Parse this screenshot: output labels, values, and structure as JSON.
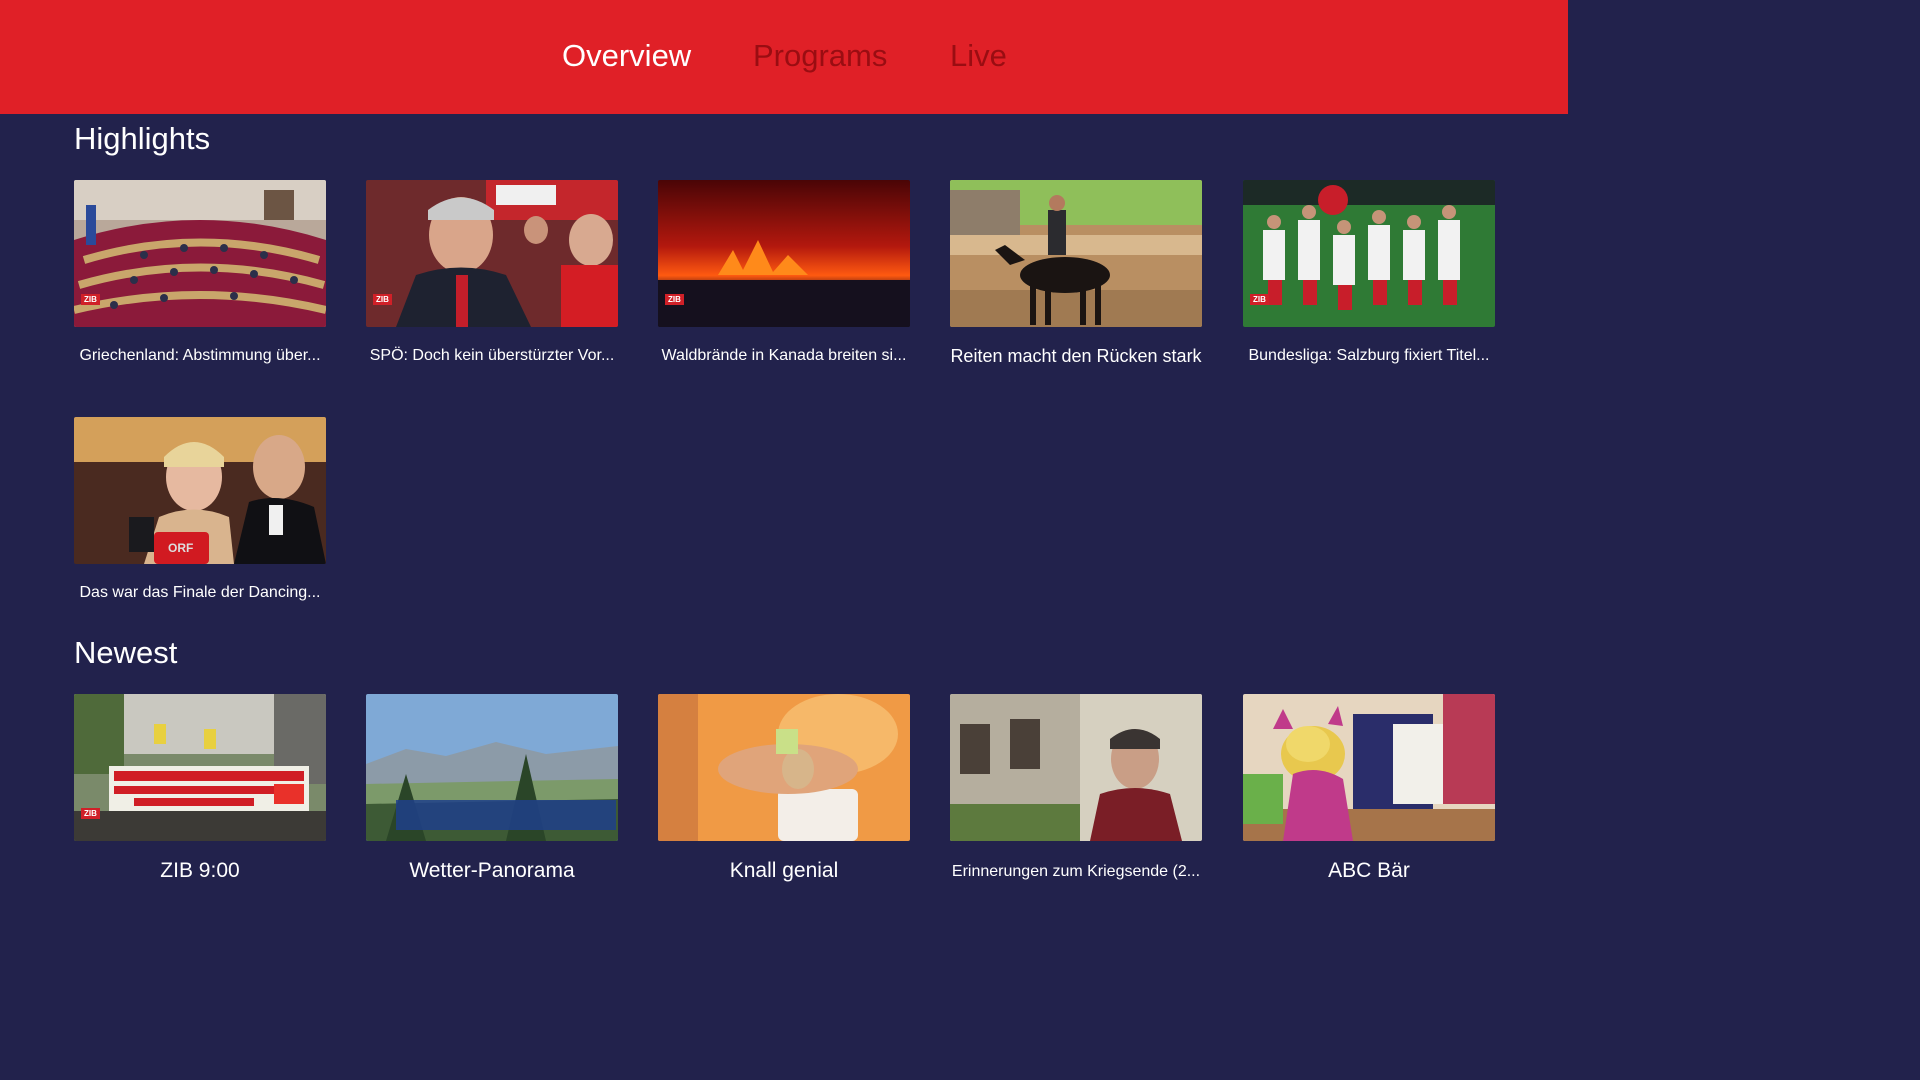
{
  "nav": {
    "tabs": [
      {
        "label": "Overview"
      },
      {
        "label": "Programs"
      },
      {
        "label": "Live"
      }
    ]
  },
  "highlights": {
    "title": "Highlights",
    "items": [
      {
        "label": "Griechenland: Abstimmung über..."
      },
      {
        "label": "SPÖ: Doch kein überstürzter Vor..."
      },
      {
        "label": "Waldbrände in Kanada breiten si..."
      },
      {
        "label": "Reiten macht den Rücken stark"
      },
      {
        "label": "Bundesliga: Salzburg fixiert Titel..."
      },
      {
        "label": "Das war das Finale der Dancing..."
      }
    ]
  },
  "newest": {
    "title": "Newest",
    "items": [
      {
        "label": "ZIB 9:00"
      },
      {
        "label": "Wetter-Panorama"
      },
      {
        "label": "Knall genial"
      },
      {
        "label": "Erinnerungen zum Kriegsende (2..."
      },
      {
        "label": "ABC Bär"
      }
    ]
  },
  "thumb_badges": {
    "zib": "ZIB",
    "orf": "ORF"
  }
}
